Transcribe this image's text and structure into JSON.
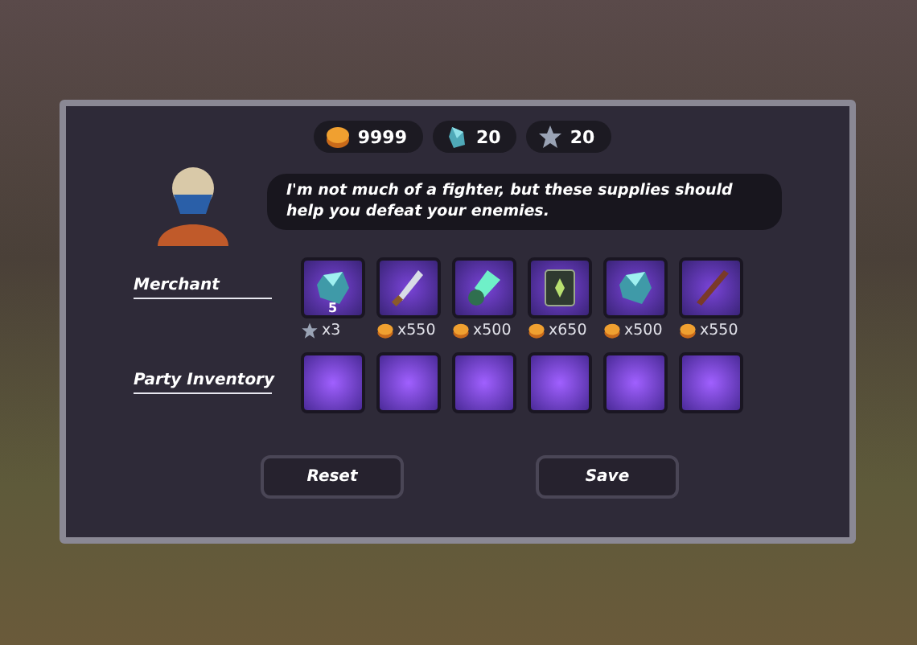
{
  "currencies": [
    {
      "kind": "coin",
      "amount": "9999"
    },
    {
      "kind": "gem",
      "amount": "20"
    },
    {
      "kind": "star",
      "amount": "20"
    }
  ],
  "npc_speech": "I'm not much of a fighter, but these supplies should help you defeat your enemies.",
  "merchant": {
    "label": "Merchant",
    "items": [
      {
        "kind": "crystal",
        "count": "5",
        "price": {
          "kind": "star",
          "text": "x3"
        }
      },
      {
        "kind": "dagger",
        "price": {
          "kind": "coin",
          "text": "x550"
        }
      },
      {
        "kind": "vial",
        "price": {
          "kind": "coin",
          "text": "x500"
        }
      },
      {
        "kind": "card",
        "price": {
          "kind": "coin",
          "text": "x650"
        }
      },
      {
        "kind": "crystal",
        "price": {
          "kind": "coin",
          "text": "x500"
        }
      },
      {
        "kind": "stick",
        "price": {
          "kind": "coin",
          "text": "x550"
        }
      }
    ]
  },
  "party_inventory": {
    "label": "Party Inventory",
    "slots": [
      {
        "kind": "empty"
      },
      {
        "kind": "empty"
      },
      {
        "kind": "empty"
      },
      {
        "kind": "empty"
      },
      {
        "kind": "empty"
      },
      {
        "kind": "empty"
      }
    ]
  },
  "buttons": [
    {
      "label": "Reset"
    },
    {
      "label": "Save"
    }
  ]
}
